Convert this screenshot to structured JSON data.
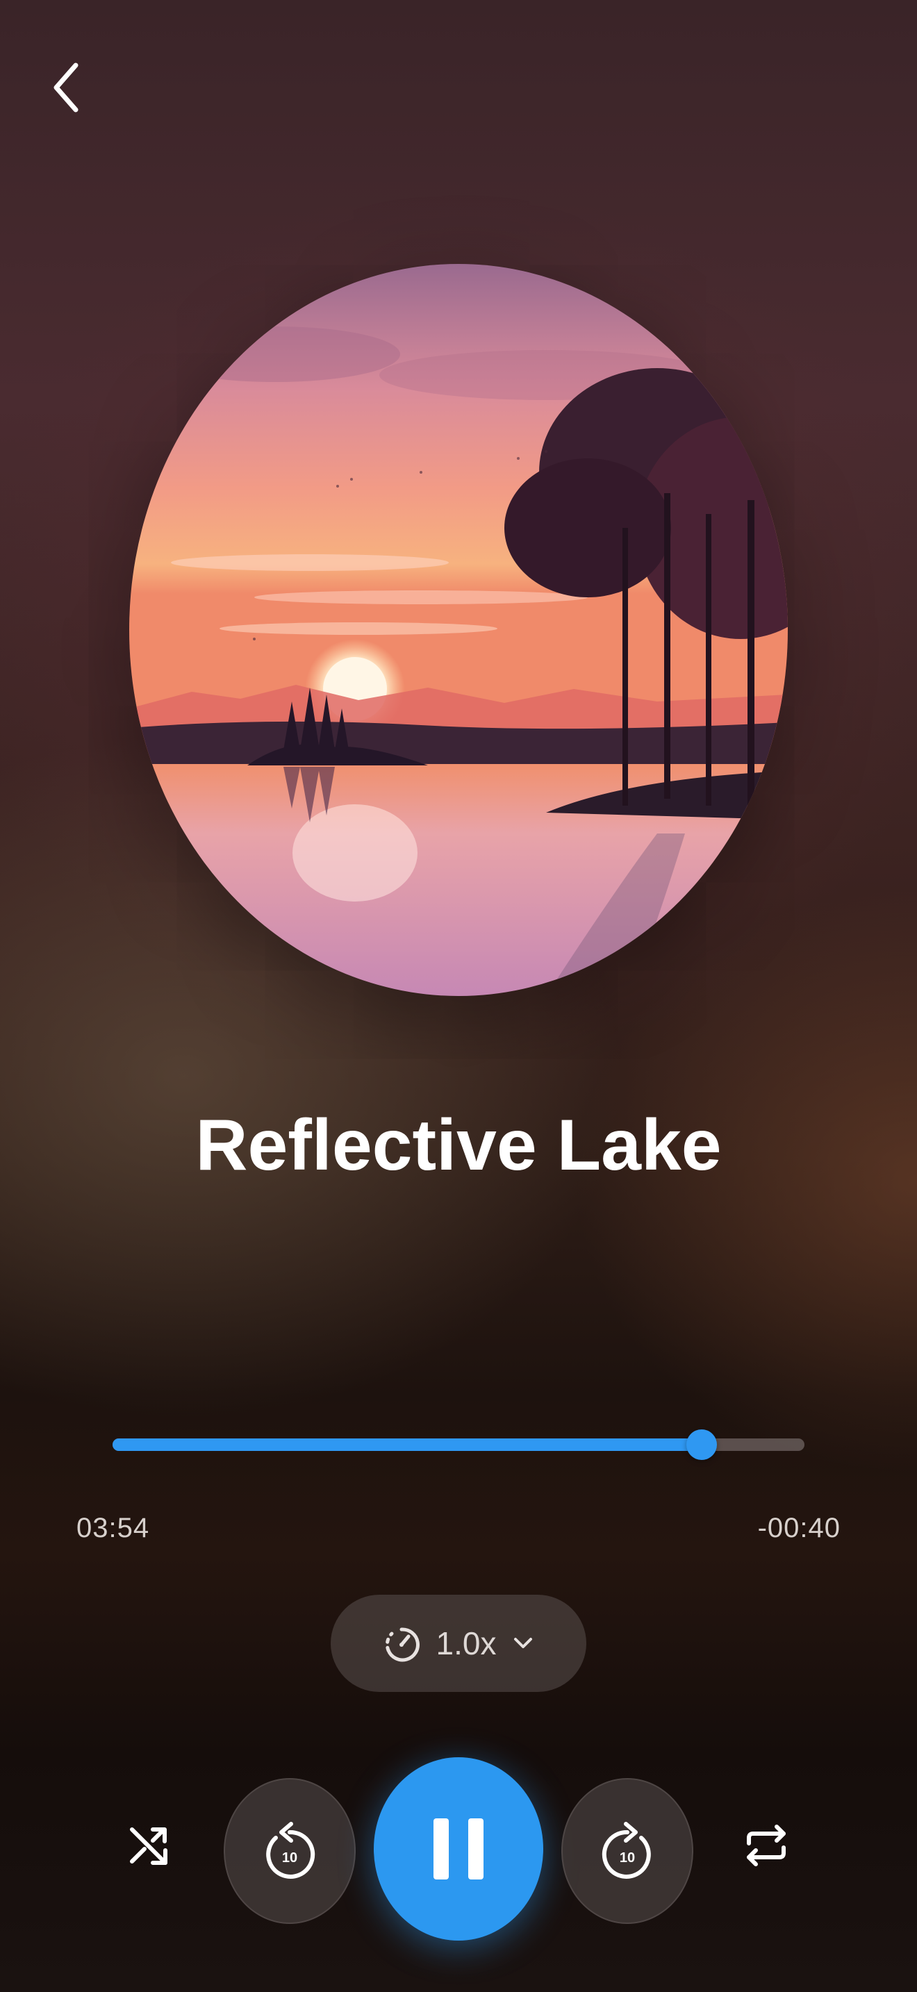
{
  "header": {
    "back_icon": "chevron-left-icon"
  },
  "track": {
    "title": "Reflective Lake",
    "artwork_icon": "lake-sunset-artwork"
  },
  "progress": {
    "elapsed": "03:54",
    "remaining": "-00:40",
    "fraction": 0.851
  },
  "speed": {
    "label": "1.0x",
    "icon": "speedometer-icon",
    "dropdown_icon": "chevron-down-icon"
  },
  "controls": {
    "shuffle_icon": "shuffle-icon",
    "rewind_icon": "rewind-10-icon",
    "rewind_seconds": "10",
    "play_pause_icon": "pause-icon",
    "forward_icon": "forward-10-icon",
    "forward_seconds": "10",
    "repeat_icon": "repeat-icon"
  },
  "colors": {
    "accent": "#2f98f2",
    "track": "#8c8282"
  }
}
